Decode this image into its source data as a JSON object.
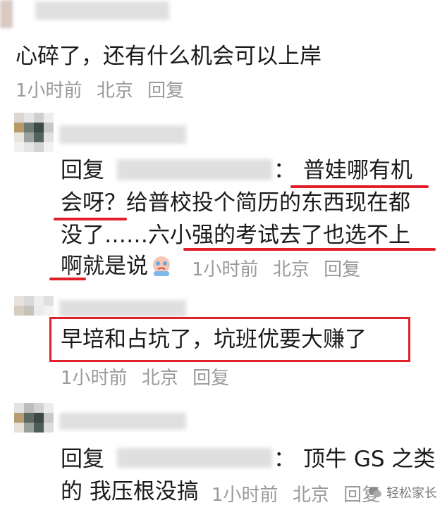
{
  "comment1": {
    "text": "心碎了，还有什么机会可以上岸",
    "time": "1小时前",
    "location": "北京",
    "reply": "回复"
  },
  "comment2": {
    "reply_prefix": "回复",
    "colon": "：",
    "line1": "普娃哪有机",
    "line2": "会呀？给普校投个简历的东西现在都",
    "line3": "没了……六小强的考试去了也选不上",
    "line4": "啊就是说",
    "time": "1小时前",
    "location": "北京",
    "reply": "回复"
  },
  "comment3": {
    "text": "早培和占坑了，坑班优要大赚了",
    "time": "1小时前",
    "location": "北京",
    "reply": "回复"
  },
  "comment4": {
    "reply_prefix": "回复",
    "colon": "：",
    "line1": "顶牛 GS 之类",
    "line2": "的 我压根没搞",
    "time": "1小时前",
    "location": "北京",
    "reply": "回复"
  },
  "watermark": {
    "text": "轻松家长",
    "icon": "wechat-icon"
  },
  "colors": {
    "highlight": "#e0202a",
    "meta": "#9a9a9a"
  }
}
